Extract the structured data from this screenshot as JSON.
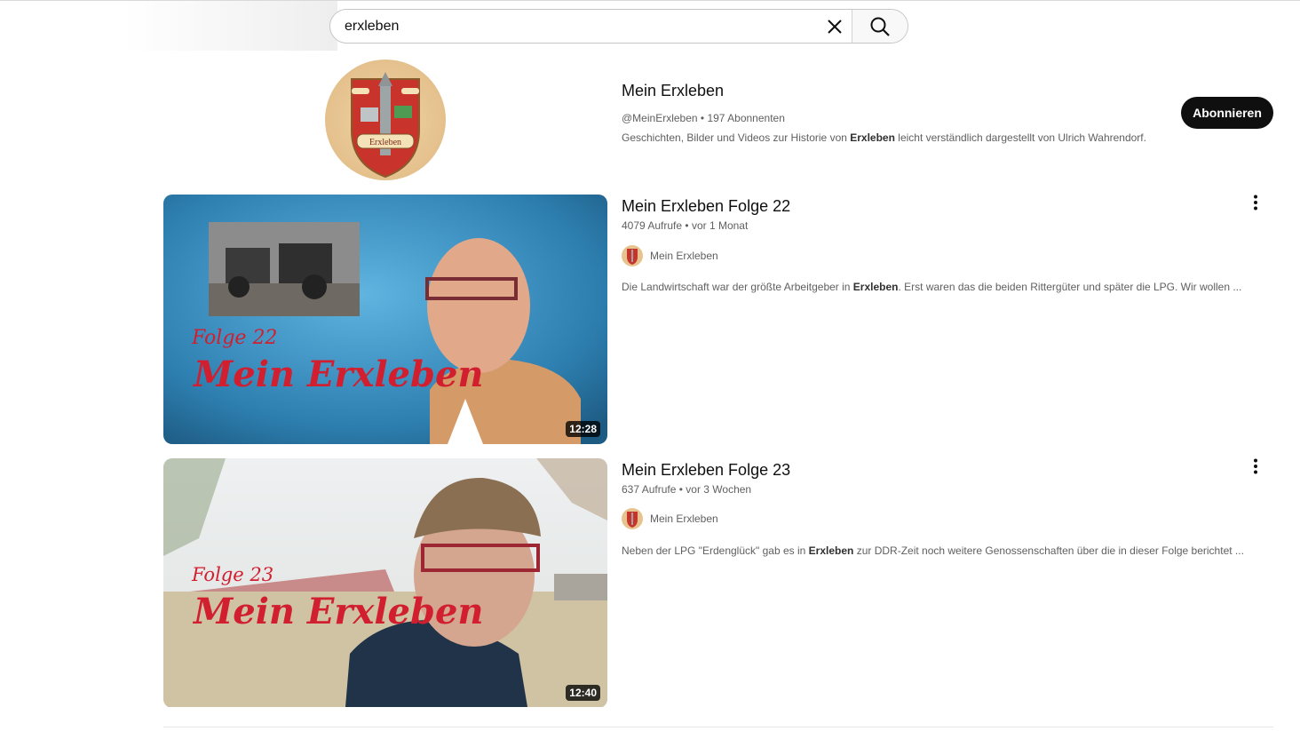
{
  "search": {
    "query": "erxleben",
    "clear_icon": "close-icon",
    "search_icon": "search-icon"
  },
  "channel": {
    "name": "Mein Erxleben",
    "handle": "@MeinErxleben",
    "separator": "•",
    "subscribers": "197 Abonnenten",
    "desc_before": "Geschichten, Bilder und Videos zur Historie von ",
    "desc_highlight": "Erxleben",
    "desc_after": " leicht verständlich dargestellt von Ulrich Wahrendorf.",
    "subscribe_label": "Abonnieren",
    "avatar_text": "Erxleben"
  },
  "videos": [
    {
      "title": "Mein Erxleben Folge 22",
      "views": "4079 Aufrufe",
      "separator": "•",
      "age": "vor 1 Monat",
      "channel": "Mein Erxleben",
      "desc_before": "Die Landwirtschaft war der größte Arbeitgeber in ",
      "desc_highlight": "Erxleben",
      "desc_after": ". Erst waren das die beiden Rittergüter und später die LPG. Wir wollen ...",
      "duration": "12:28",
      "thumb_folge": "Folge 22",
      "thumb_title": "Mein Erxleben"
    },
    {
      "title": "Mein Erxleben Folge 23",
      "views": "637 Aufrufe",
      "separator": "•",
      "age": "vor 3 Wochen",
      "channel": "Mein Erxleben",
      "desc_before": "Neben der LPG \"Erdenglück\" gab es in ",
      "desc_highlight": "Erxleben",
      "desc_after": " zur DDR-Zeit noch weitere Genossenschaften über die in dieser Folge berichtet ...",
      "duration": "12:40",
      "thumb_folge": "Folge 23",
      "thumb_title": "Mein Erxleben"
    }
  ],
  "colors": {
    "subscribe_bg": "#0f0f0f",
    "thumb_title_red": "#d11f2f"
  }
}
